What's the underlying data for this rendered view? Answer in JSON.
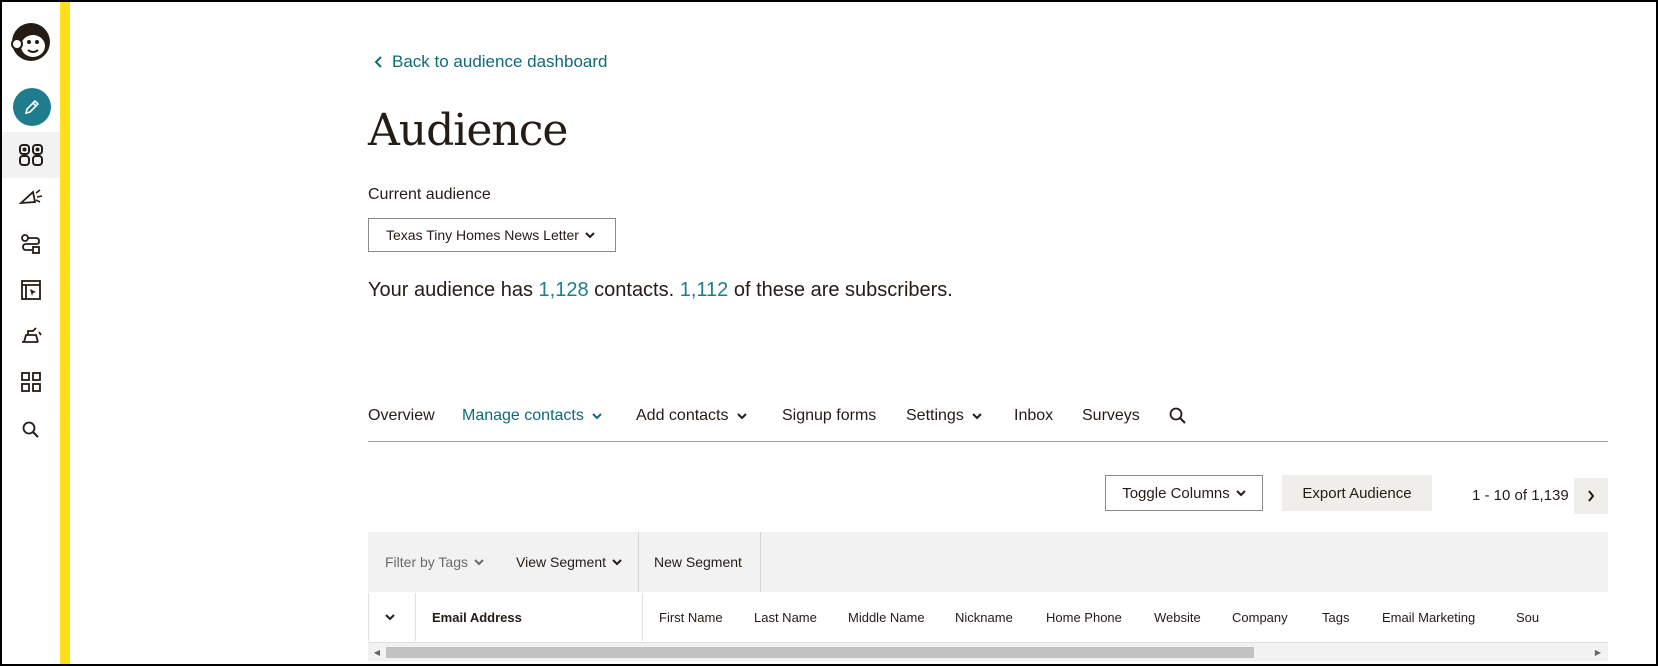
{
  "sidebar": {
    "logo": "mailchimp-freddie-logo",
    "create_icon": "pencil-icon",
    "items": [
      {
        "icon": "audience-icon"
      },
      {
        "icon": "megaphone-icon"
      },
      {
        "icon": "automations-icon"
      },
      {
        "icon": "website-icon"
      },
      {
        "icon": "integrations-icon"
      },
      {
        "icon": "grid-icon"
      },
      {
        "icon": "search-icon"
      }
    ]
  },
  "header": {
    "back_link": "Back to audience dashboard",
    "title": "Audience",
    "current_audience_label": "Current audience",
    "audience_select_value": "Texas Tiny Homes News Letter"
  },
  "summary": {
    "part1": "Your audience has ",
    "contacts_count": "1,128",
    "part2": " contacts. ",
    "subscribers_count": "1,112",
    "part3": " of these are subscribers."
  },
  "tabs": [
    {
      "label": "Overview"
    },
    {
      "label": "Manage contacts"
    },
    {
      "label": "Add contacts"
    },
    {
      "label": "Signup forms"
    },
    {
      "label": "Settings"
    },
    {
      "label": "Inbox"
    },
    {
      "label": "Surveys"
    }
  ],
  "toolbar": {
    "toggle_columns": "Toggle Columns",
    "export_audience": "Export Audience",
    "pagination": "1 - 10 of 1,139"
  },
  "filters": {
    "filter_tags": "Filter by Tags",
    "view_segment": "View Segment",
    "new_segment": "New Segment"
  },
  "table": {
    "columns": [
      "Email Address",
      "First Name",
      "Last Name",
      "Middle Name",
      "Nickname",
      "Home Phone",
      "Website",
      "Company",
      "Tags",
      "Email Marketing",
      "Sou"
    ]
  },
  "colors": {
    "accent": "#1e7c8c",
    "link": "#0f6a7a",
    "brand_yellow": "#ffe01b"
  }
}
